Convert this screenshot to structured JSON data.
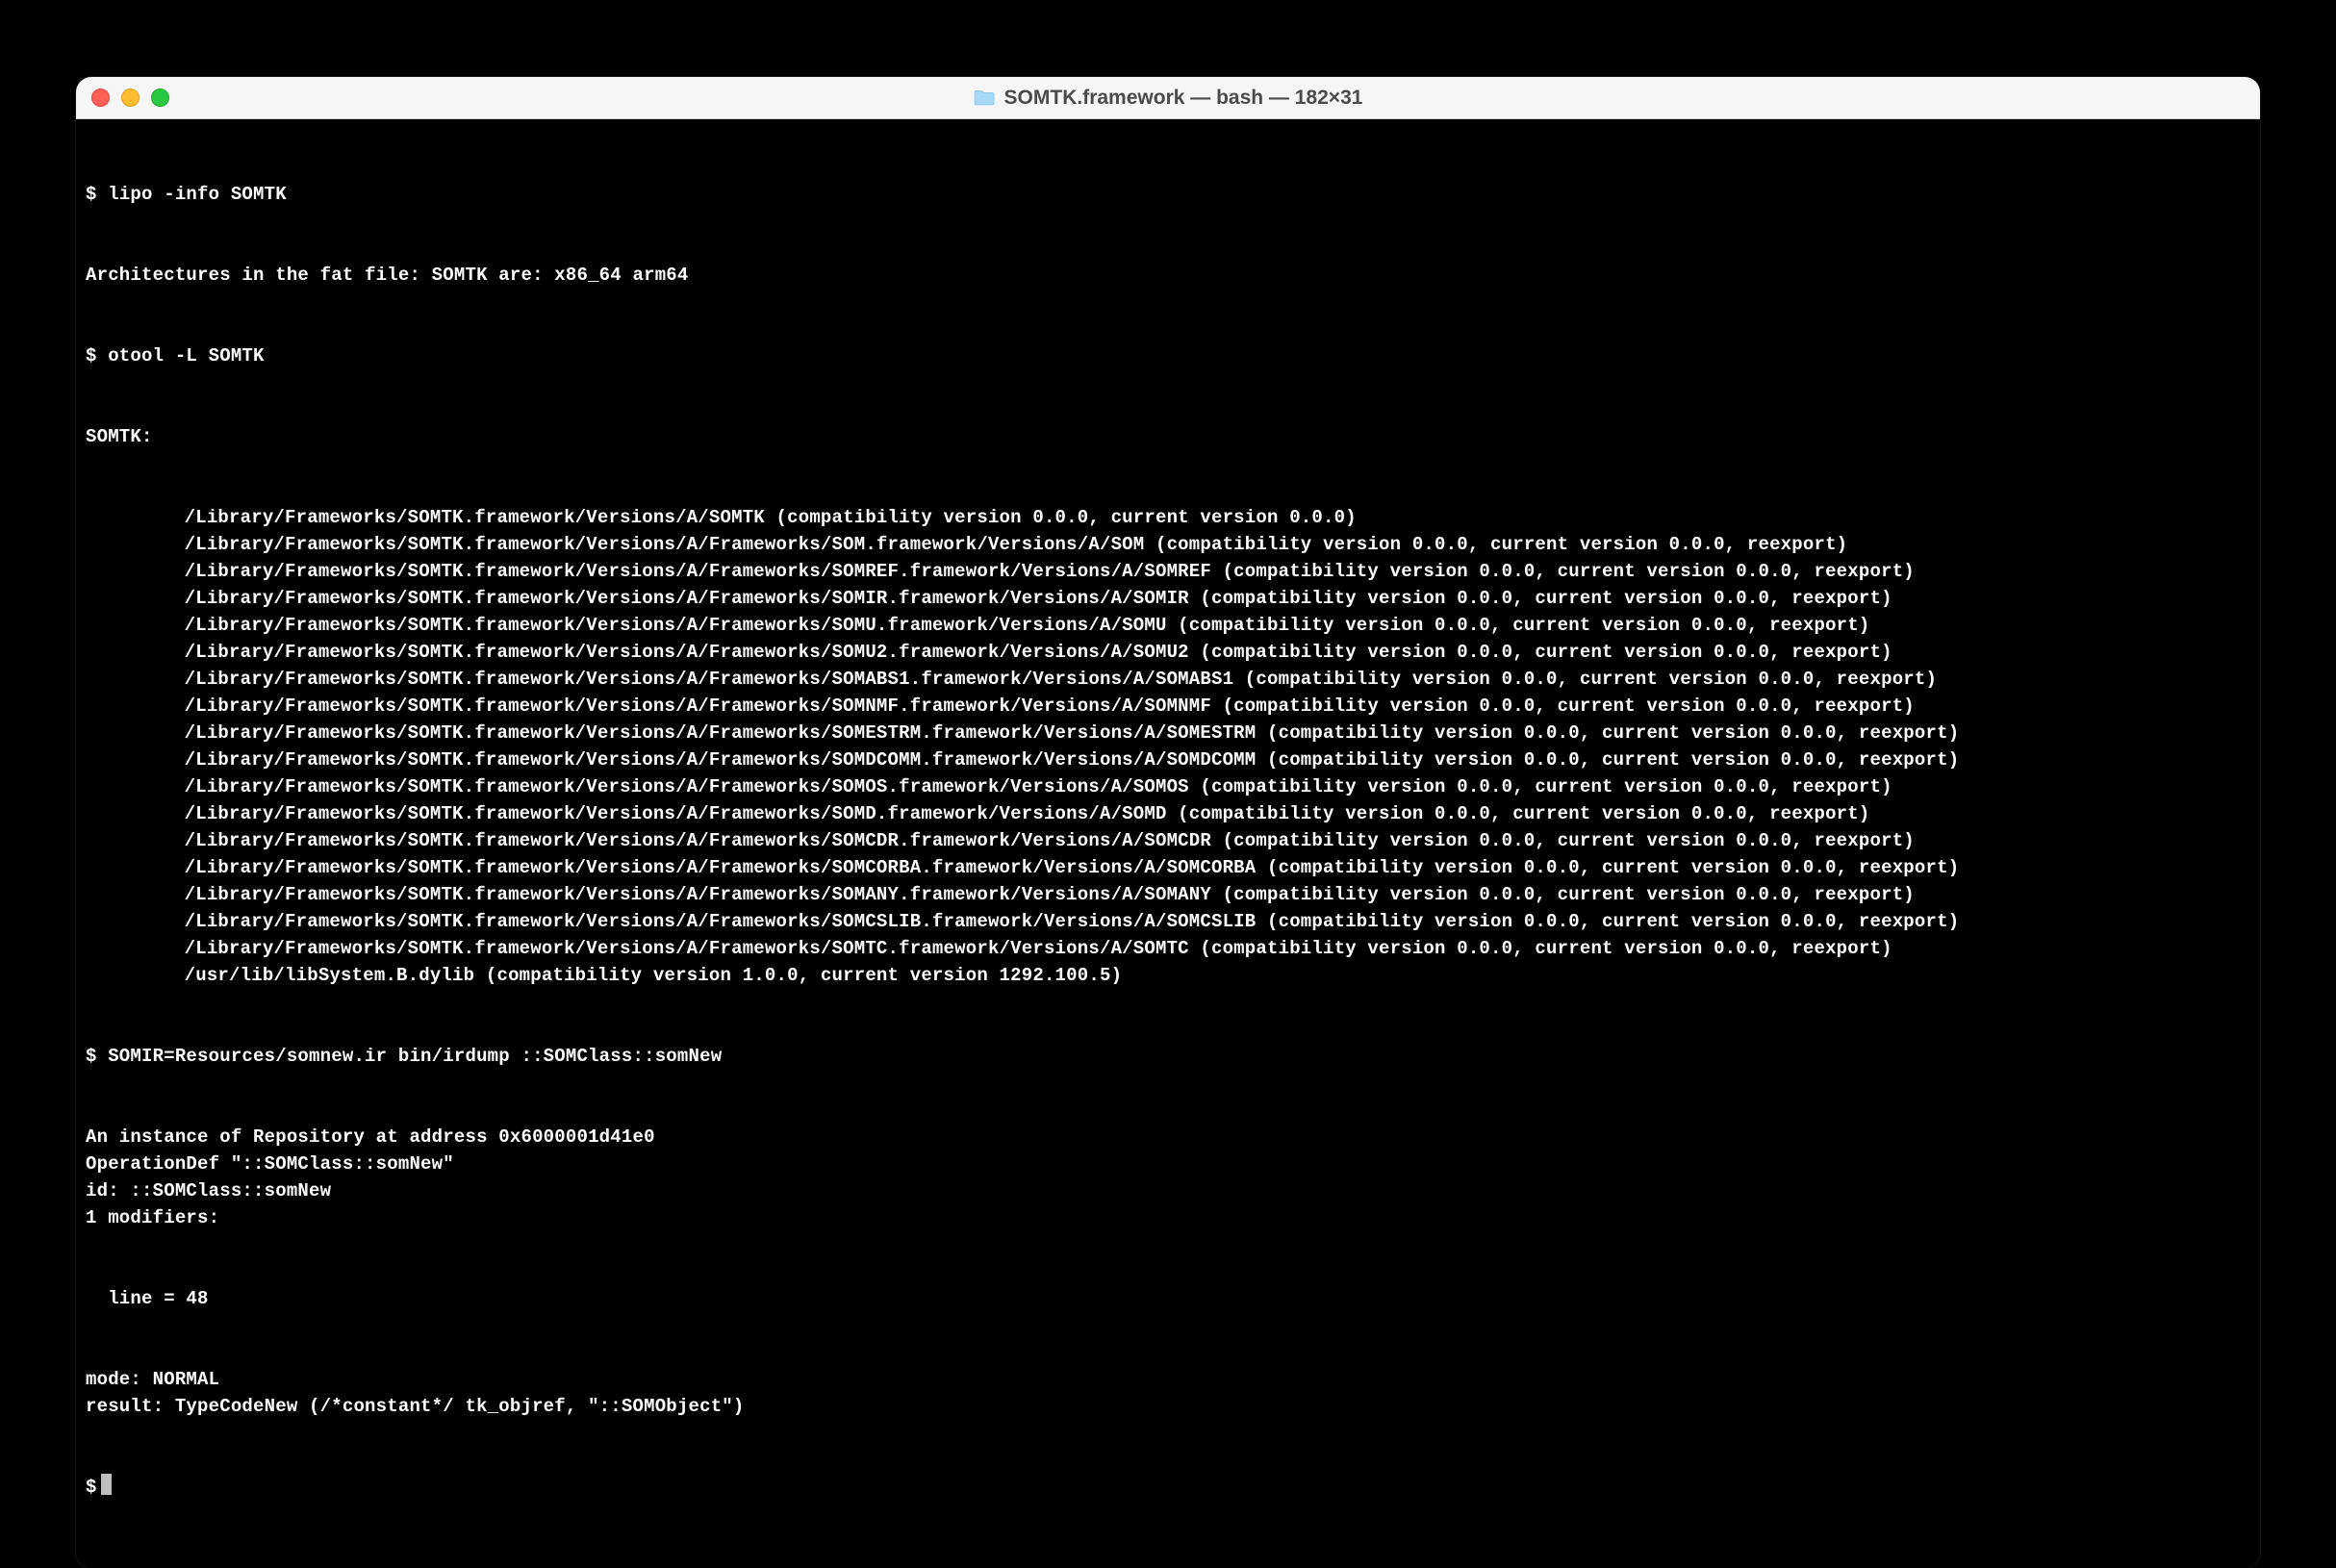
{
  "window": {
    "title": "SOMTK.framework — bash — 182×31",
    "traffic": {
      "red": "#ff5f57",
      "yellow": "#febc2e",
      "green": "#28c840"
    }
  },
  "terminal": {
    "prompt": "$",
    "cmd1": "$ lipo -info SOMTK",
    "cmd1_out": "Architectures in the fat file: SOMTK are: x86_64 arm64",
    "cmd2": "$ otool -L SOMTK",
    "cmd2_header": "SOMTK:",
    "libs": [
      "/Library/Frameworks/SOMTK.framework/Versions/A/SOMTK (compatibility version 0.0.0, current version 0.0.0)",
      "/Library/Frameworks/SOMTK.framework/Versions/A/Frameworks/SOM.framework/Versions/A/SOM (compatibility version 0.0.0, current version 0.0.0, reexport)",
      "/Library/Frameworks/SOMTK.framework/Versions/A/Frameworks/SOMREF.framework/Versions/A/SOMREF (compatibility version 0.0.0, current version 0.0.0, reexport)",
      "/Library/Frameworks/SOMTK.framework/Versions/A/Frameworks/SOMIR.framework/Versions/A/SOMIR (compatibility version 0.0.0, current version 0.0.0, reexport)",
      "/Library/Frameworks/SOMTK.framework/Versions/A/Frameworks/SOMU.framework/Versions/A/SOMU (compatibility version 0.0.0, current version 0.0.0, reexport)",
      "/Library/Frameworks/SOMTK.framework/Versions/A/Frameworks/SOMU2.framework/Versions/A/SOMU2 (compatibility version 0.0.0, current version 0.0.0, reexport)",
      "/Library/Frameworks/SOMTK.framework/Versions/A/Frameworks/SOMABS1.framework/Versions/A/SOMABS1 (compatibility version 0.0.0, current version 0.0.0, reexport)",
      "/Library/Frameworks/SOMTK.framework/Versions/A/Frameworks/SOMNMF.framework/Versions/A/SOMNMF (compatibility version 0.0.0, current version 0.0.0, reexport)",
      "/Library/Frameworks/SOMTK.framework/Versions/A/Frameworks/SOMESTRM.framework/Versions/A/SOMESTRM (compatibility version 0.0.0, current version 0.0.0, reexport)",
      "/Library/Frameworks/SOMTK.framework/Versions/A/Frameworks/SOMDCOMM.framework/Versions/A/SOMDCOMM (compatibility version 0.0.0, current version 0.0.0, reexport)",
      "/Library/Frameworks/SOMTK.framework/Versions/A/Frameworks/SOMOS.framework/Versions/A/SOMOS (compatibility version 0.0.0, current version 0.0.0, reexport)",
      "/Library/Frameworks/SOMTK.framework/Versions/A/Frameworks/SOMD.framework/Versions/A/SOMD (compatibility version 0.0.0, current version 0.0.0, reexport)",
      "/Library/Frameworks/SOMTK.framework/Versions/A/Frameworks/SOMCDR.framework/Versions/A/SOMCDR (compatibility version 0.0.0, current version 0.0.0, reexport)",
      "/Library/Frameworks/SOMTK.framework/Versions/A/Frameworks/SOMCORBA.framework/Versions/A/SOMCORBA (compatibility version 0.0.0, current version 0.0.0, reexport)",
      "/Library/Frameworks/SOMTK.framework/Versions/A/Frameworks/SOMANY.framework/Versions/A/SOMANY (compatibility version 0.0.0, current version 0.0.0, reexport)",
      "/Library/Frameworks/SOMTK.framework/Versions/A/Frameworks/SOMCSLIB.framework/Versions/A/SOMCSLIB (compatibility version 0.0.0, current version 0.0.0, reexport)",
      "/Library/Frameworks/SOMTK.framework/Versions/A/Frameworks/SOMTC.framework/Versions/A/SOMTC (compatibility version 0.0.0, current version 0.0.0, reexport)",
      "/usr/lib/libSystem.B.dylib (compatibility version 1.0.0, current version 1292.100.5)"
    ],
    "cmd3": "$ SOMIR=Resources/somnew.ir bin/irdump ::SOMClass::somNew",
    "cmd3_out": [
      "An instance of Repository at address 0x6000001d41e0",
      "OperationDef \"::SOMClass::somNew\"",
      "id: ::SOMClass::somNew",
      "1 modifiers:"
    ],
    "cmd3_out_indent": "  line = 48",
    "cmd3_out_tail": [
      "mode: NORMAL",
      "result: TypeCodeNew (/*constant*/ tk_objref, \"::SOMObject\")"
    ],
    "final_prompt": "$"
  }
}
